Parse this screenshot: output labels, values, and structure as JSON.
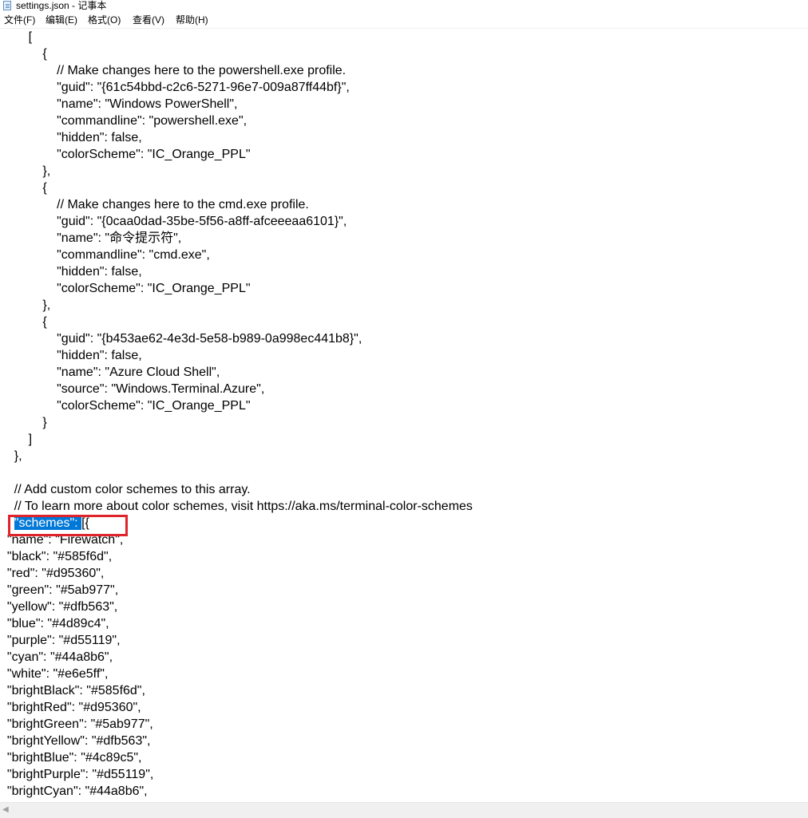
{
  "window": {
    "title": "settings.json - 记事本"
  },
  "menu": [
    {
      "label": "文件(F)"
    },
    {
      "label": "编辑(E)"
    },
    {
      "label": "格式(O)"
    },
    {
      "label": "查看(V)"
    },
    {
      "label": "帮助(H)"
    }
  ],
  "editor": {
    "lines": [
      "        [",
      "            {",
      "                // Make changes here to the powershell.exe profile.",
      "                \"guid\": \"{61c54bbd-c2c6-5271-96e7-009a87ff44bf}\",",
      "                \"name\": \"Windows PowerShell\",",
      "                \"commandline\": \"powershell.exe\",",
      "                \"hidden\": false,",
      "                \"colorScheme\": \"IC_Orange_PPL\"",
      "            },",
      "            {",
      "                // Make changes here to the cmd.exe profile.",
      "                \"guid\": \"{0caa0dad-35be-5f56-a8ff-afceeeaa6101}\",",
      "                \"name\": \"命令提示符\",",
      "                \"commandline\": \"cmd.exe\",",
      "                \"hidden\": false,",
      "                \"colorScheme\": \"IC_Orange_PPL\"",
      "            },",
      "            {",
      "                \"guid\": \"{b453ae62-4e3d-5e58-b989-0a998ec441b8}\",",
      "                \"hidden\": false,",
      "                \"name\": \"Azure Cloud Shell\",",
      "                \"source\": \"Windows.Terminal.Azure\",",
      "                \"colorScheme\": \"IC_Orange_PPL\"",
      "            }",
      "        ]",
      "    },",
      "",
      "    // Add custom color schemes to this array.",
      "    // To learn more about color schemes, visit https://aka.ms/terminal-color-schemes",
      "__SCHEMES__",
      "  \"name\": \"Firewatch\",",
      "  \"black\": \"#585f6d\",",
      "  \"red\": \"#d95360\",",
      "  \"green\": \"#5ab977\",",
      "  \"yellow\": \"#dfb563\",",
      "  \"blue\": \"#4d89c4\",",
      "  \"purple\": \"#d55119\",",
      "  \"cyan\": \"#44a8b6\",",
      "  \"white\": \"#e6e5ff\",",
      "  \"brightBlack\": \"#585f6d\",",
      "  \"brightRed\": \"#d95360\",",
      "  \"brightGreen\": \"#5ab977\",",
      "  \"brightYellow\": \"#dfb563\",",
      "  \"brightBlue\": \"#4c89c5\",",
      "  \"brightPurple\": \"#d55119\",",
      "  \"brightCyan\": \"#44a8b6\","
    ],
    "schemes_line": {
      "indent": "    ",
      "selected": "\"schemes\": ",
      "rest": "[{"
    },
    "selection_color": "#0078d7",
    "highlight_box_color": "#e0242c"
  },
  "icons": {
    "title": "notepad-icon",
    "scroll_left": "scroll-left-arrow-icon"
  }
}
